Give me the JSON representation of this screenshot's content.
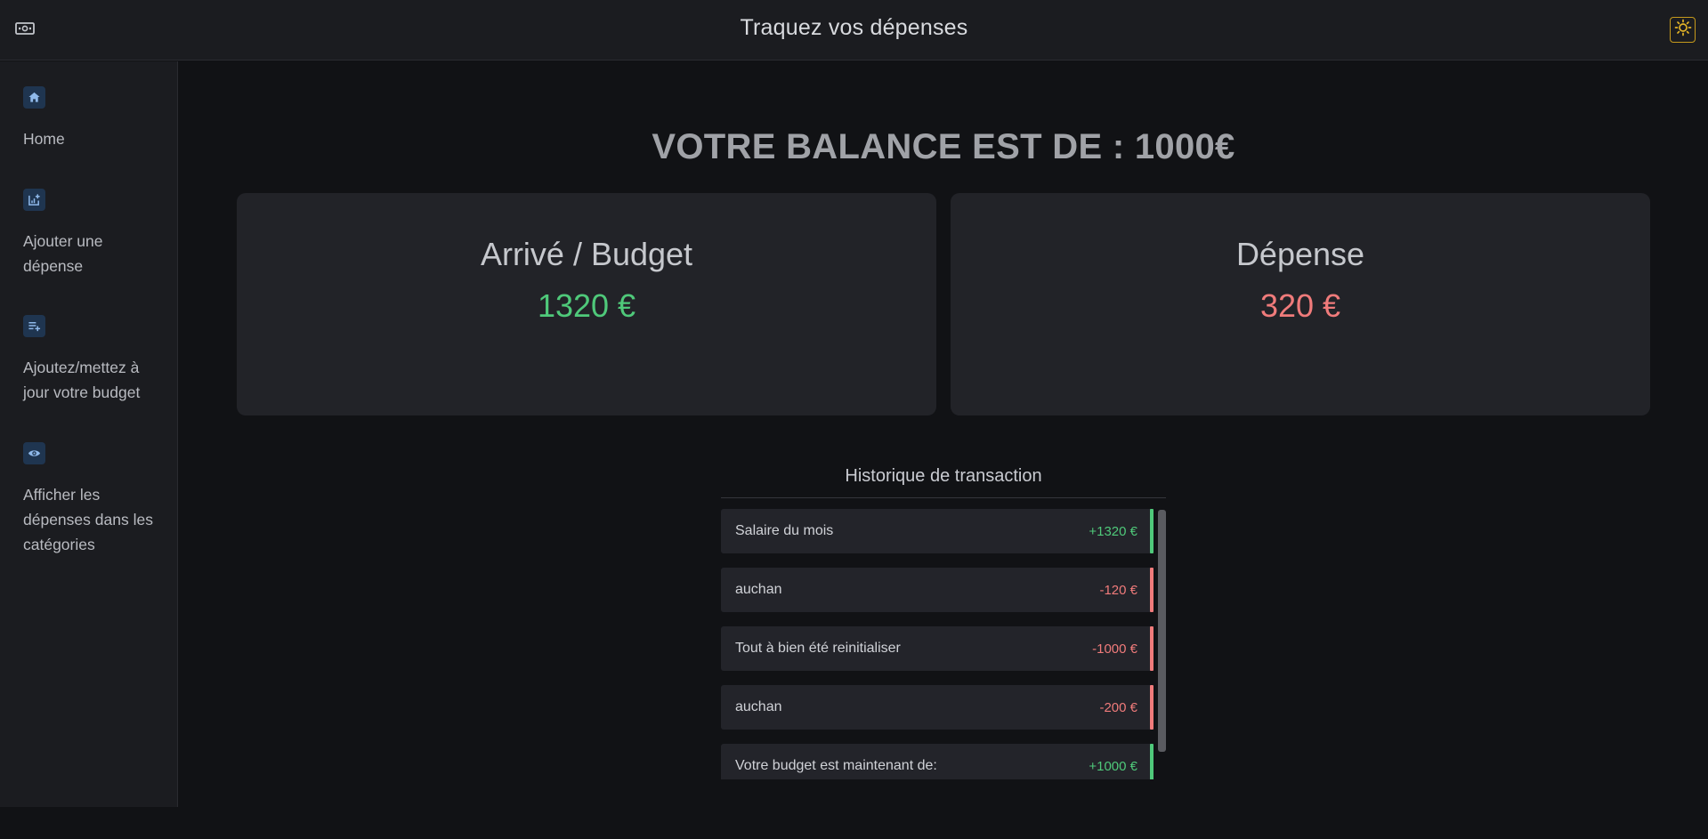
{
  "header": {
    "title": "Traquez vos dépenses",
    "logo_icon": "banknote-icon",
    "theme_icon": "sun-icon"
  },
  "sidebar": {
    "items": [
      {
        "label": "Home",
        "icon": "home-icon"
      },
      {
        "label": "Ajouter une dépense",
        "icon": "add-chart-icon"
      },
      {
        "label": "Ajoutez/mettez à jour votre budget",
        "icon": "playlist-add-icon"
      },
      {
        "label": "Afficher les dépenses dans les catégories",
        "icon": "eye-icon"
      }
    ]
  },
  "main": {
    "balance": "VOTRE BALANCE EST DE : 1000€",
    "cards": [
      {
        "title": "Arrivé / Budget",
        "value": "1320 €",
        "color": "#4fc97a"
      },
      {
        "title": "Dépense",
        "value": "320 €",
        "color": "#f07b7b"
      }
    ],
    "history": {
      "title": "Historique de transaction",
      "transactions": [
        {
          "label": "Salaire du mois",
          "amount": "+1320 €",
          "type": "income"
        },
        {
          "label": "auchan",
          "amount": "-120 €",
          "type": "expense"
        },
        {
          "label": "Tout à bien été reinitialiser",
          "amount": "-1000 €",
          "type": "expense"
        },
        {
          "label": "auchan",
          "amount": "-200 €",
          "type": "expense"
        },
        {
          "label": "Votre budget est maintenant de:",
          "amount": "+1000 €",
          "type": "income"
        }
      ]
    }
  },
  "colors": {
    "income": "#4fc97a",
    "expense": "#f07b7b",
    "accent_warning": "#e2b327"
  }
}
